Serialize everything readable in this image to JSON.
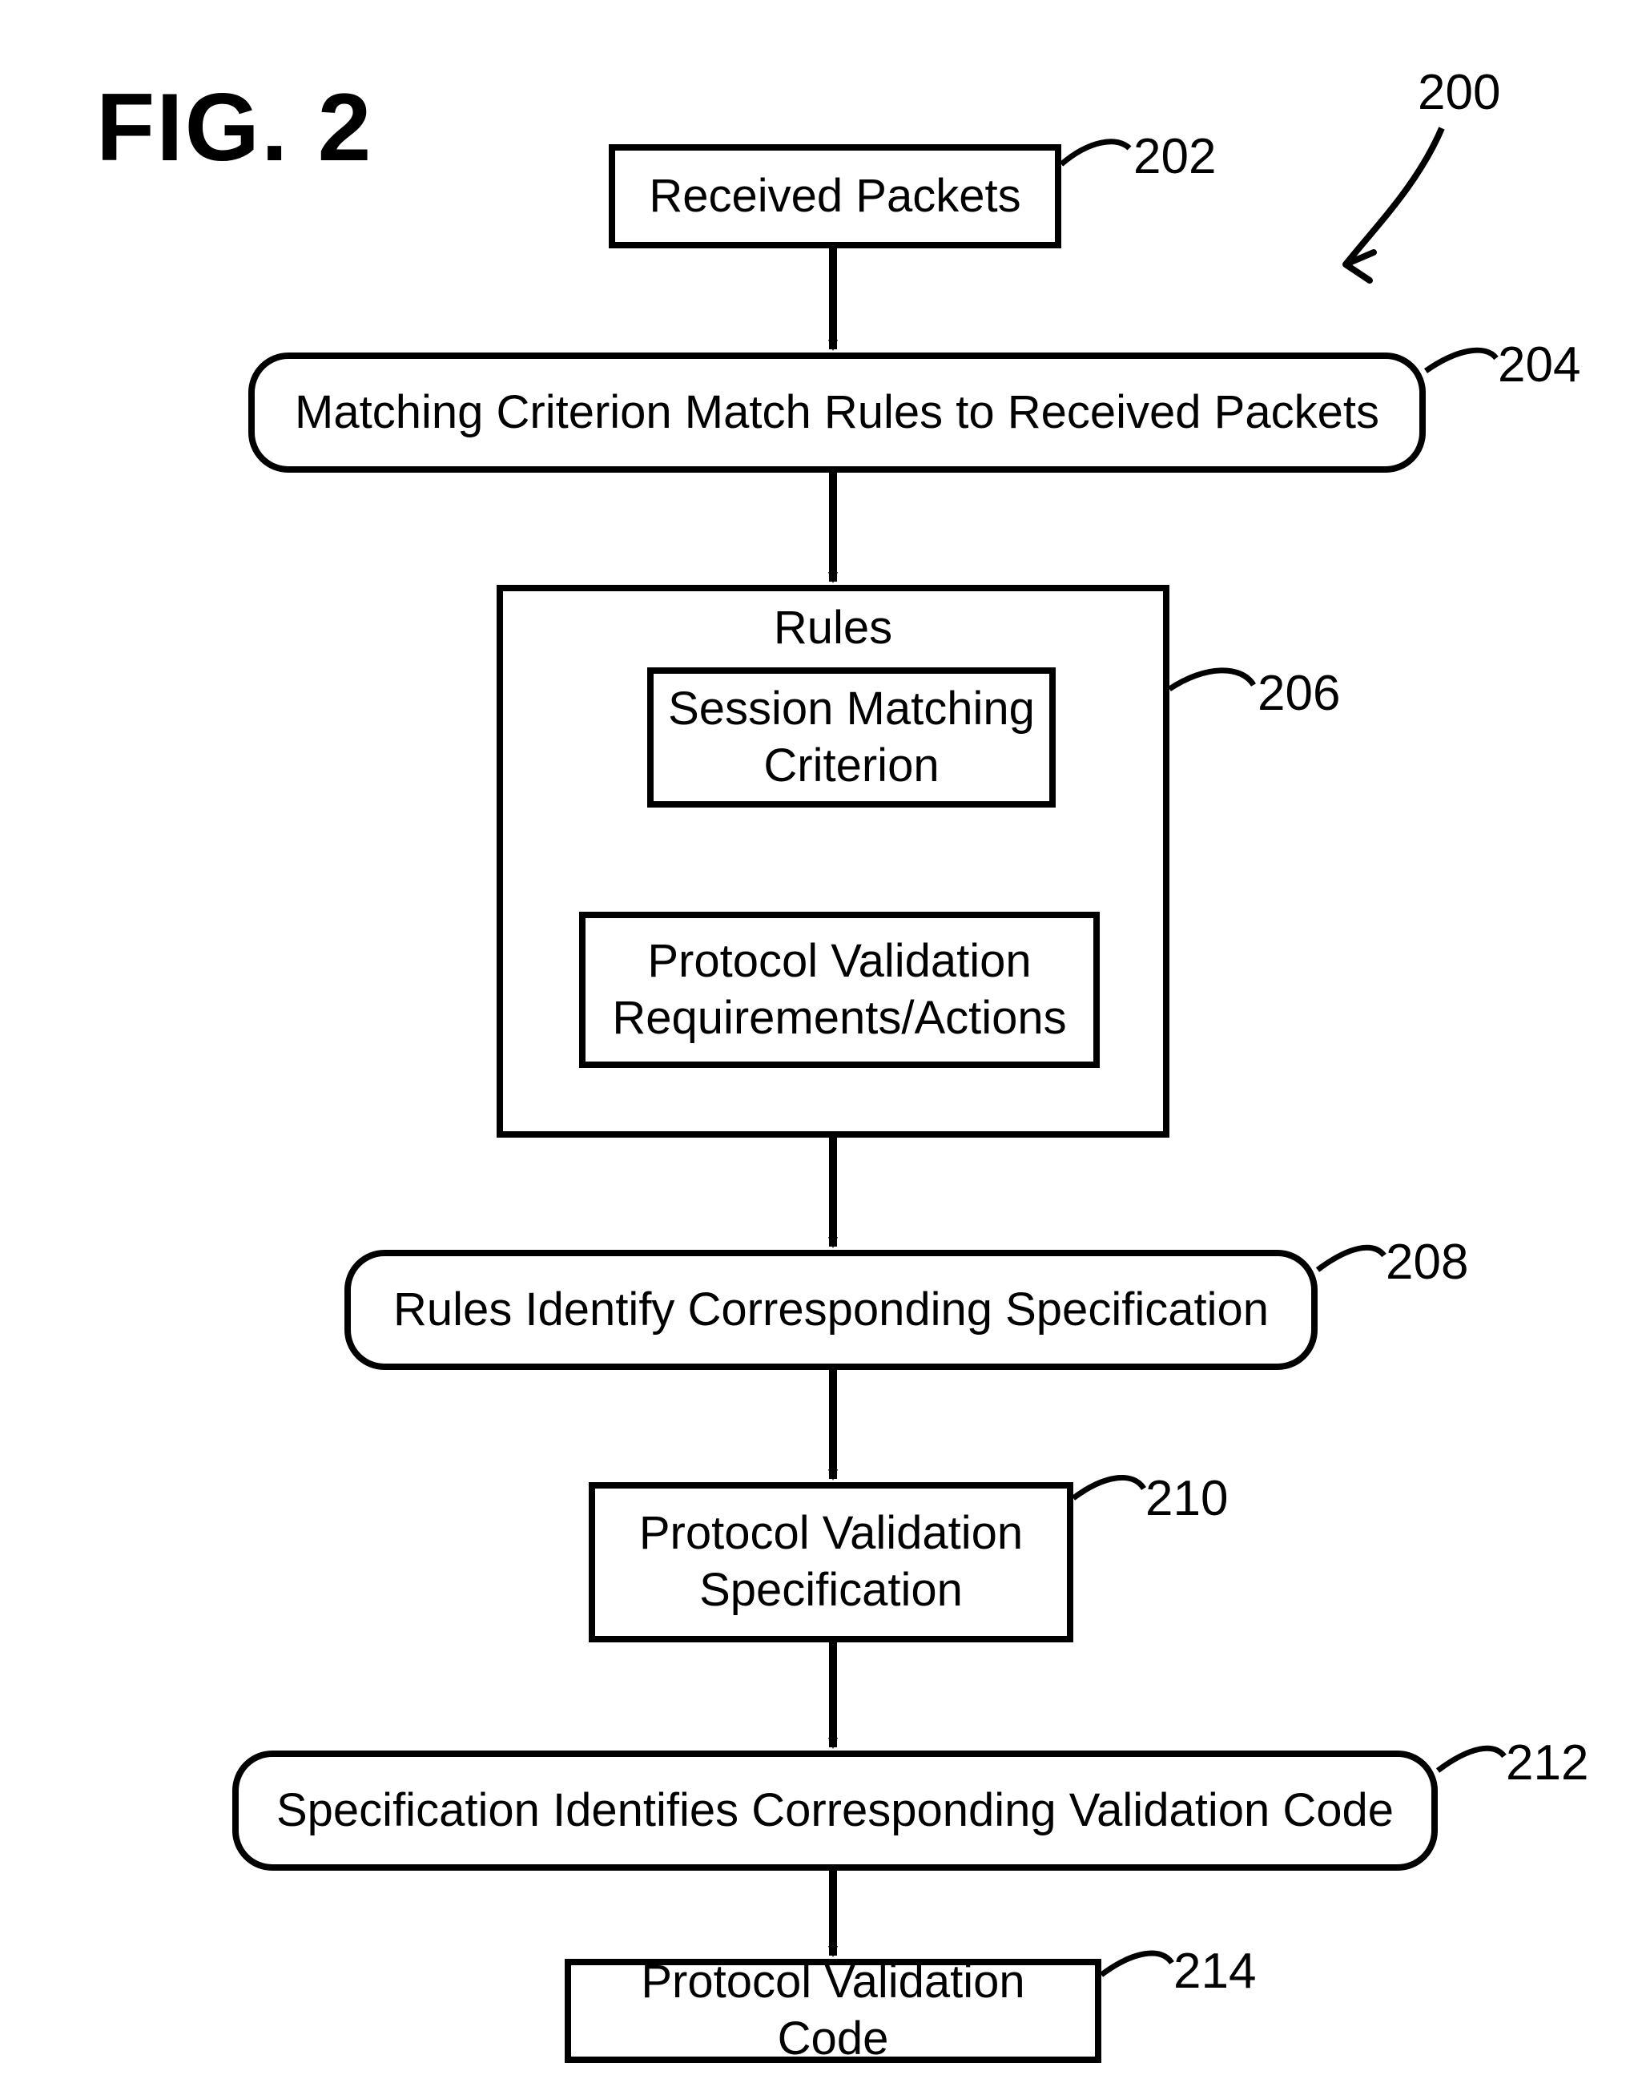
{
  "figure_label": "FIG. 2",
  "diagram_ref": "200",
  "nodes": {
    "n202": {
      "text": "Received Packets",
      "ref": "202"
    },
    "n204": {
      "text": "Matching Criterion Match Rules to Received Packets",
      "ref": "204"
    },
    "n206": {
      "title": "Rules",
      "ref": "206",
      "inner1": "Session Matching\nCriterion",
      "inner2": "Protocol Validation\nRequirements/Actions"
    },
    "n208": {
      "text": "Rules Identify Corresponding Specification",
      "ref": "208"
    },
    "n210": {
      "text": "Protocol Validation\nSpecification",
      "ref": "210"
    },
    "n212": {
      "text": "Specification Identifies Corresponding Validation Code",
      "ref": "212"
    },
    "n214": {
      "text": "Protocol Validation Code",
      "ref": "214"
    }
  }
}
